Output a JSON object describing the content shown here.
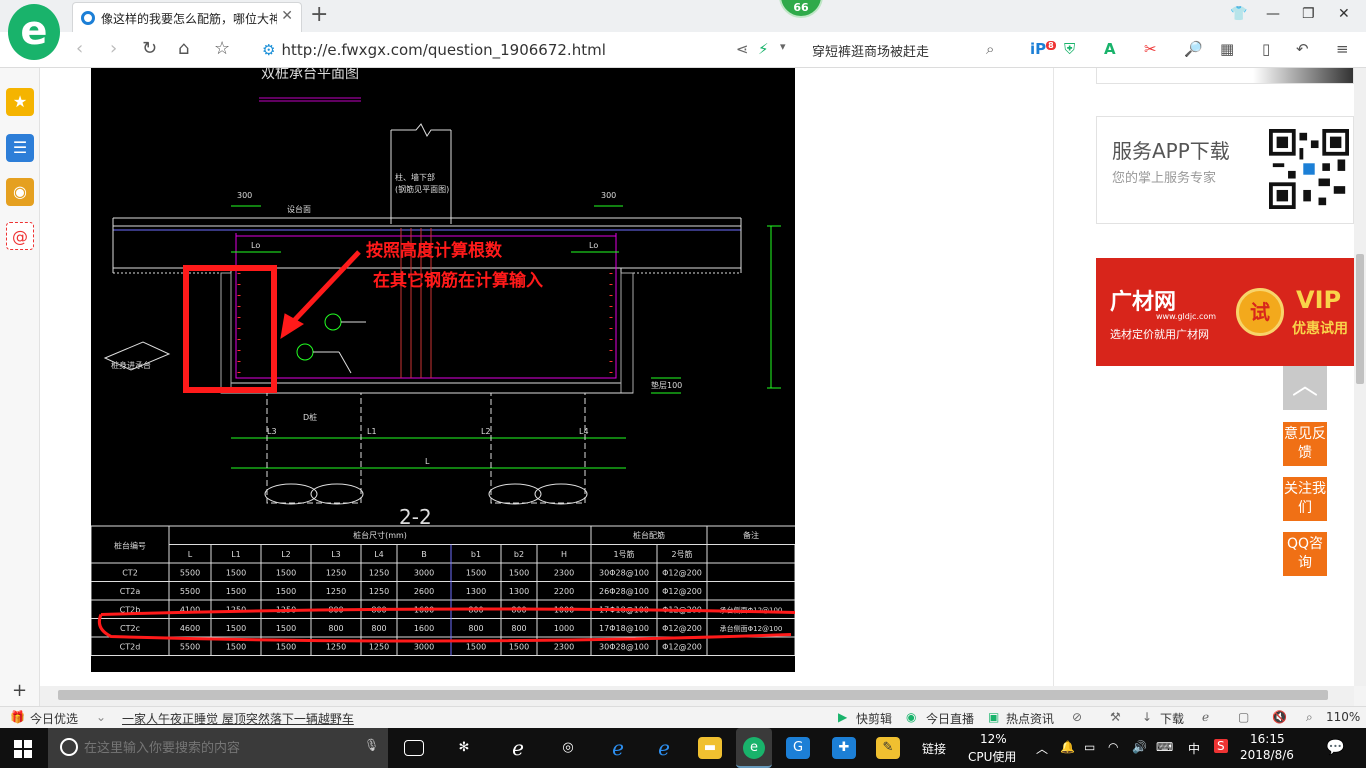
{
  "browser": {
    "tab_title": "像这样的我要怎么配筋，哪位大神",
    "badge": "66",
    "url_text": "http://e.fwxgx.com/question_1906672.html",
    "search_value": "穿短裤逛商场被赶走",
    "plugin_badge": "8"
  },
  "cad": {
    "title_top": "双桩承台平面图",
    "section_label": "2-2",
    "annotation_line1": "按照高度计算根数",
    "annotation_line2": "在其它钢筋在计算输入",
    "dims": {
      "d300a": "300",
      "d300b": "300",
      "lo_left": "Lo",
      "lo_right": "Lo",
      "l3": "L3",
      "l1": "L1",
      "l2": "L2",
      "l4": "L4",
      "l": "L",
      "dia": "D桩"
    },
    "labels": {
      "slab": "设台面",
      "column": "柱、墙下部",
      "column2": "(钢筋见平面图)",
      "bottom_label": "垫层100",
      "pile_note": "桩身进承台"
    },
    "table": {
      "header_group": "桩台尺寸(mm)",
      "header_rebar": "桩台配筋",
      "header_note": "备注",
      "header_id": "桩台编号",
      "columns": [
        "L",
        "L1",
        "L2",
        "L3",
        "L4",
        "B",
        "b1",
        "b2",
        "H",
        "1号筋",
        "2号筋"
      ],
      "rows": [
        {
          "id": "CT2",
          "cells": [
            "5500",
            "1500",
            "1500",
            "1250",
            "1250",
            "3000",
            "1500",
            "1500",
            "2300",
            "30Φ28@100",
            "Φ12@200"
          ],
          "note": ""
        },
        {
          "id": "CT2a",
          "cells": [
            "5500",
            "1500",
            "1500",
            "1250",
            "1250",
            "2600",
            "1300",
            "1300",
            "2200",
            "26Φ28@100",
            "Φ12@200"
          ],
          "note": ""
        },
        {
          "id": "CT2b",
          "cells": [
            "4100",
            "1250",
            "1250",
            "800",
            "800",
            "1600",
            "800",
            "800",
            "1000",
            "17Φ18@100",
            "Φ12@200"
          ],
          "note": "承台侧面Φ12@100"
        },
        {
          "id": "CT2c",
          "cells": [
            "4600",
            "1500",
            "1500",
            "800",
            "800",
            "1600",
            "800",
            "800",
            "1000",
            "17Φ18@100",
            "Φ12@200"
          ],
          "note": "承台侧面Φ12@100"
        },
        {
          "id": "CT2d",
          "cells": [
            "5500",
            "1500",
            "1500",
            "1250",
            "1250",
            "3000",
            "1500",
            "1500",
            "2300",
            "30Φ28@100",
            "Φ12@200"
          ],
          "note": ""
        }
      ]
    }
  },
  "sidebar_right": {
    "app_title": "服务APP下载",
    "app_subtitle": "您的掌上服务专家",
    "ad": {
      "logo": "广材网",
      "url": "www.gldjc.com",
      "slogan": "选材定价就用广材网",
      "try": "试",
      "vip": "VIP",
      "vip_sub": "优惠试用"
    },
    "buttons": {
      "feedback": "意见反馈",
      "follow": "关注我们",
      "qq": "QQ咨询"
    }
  },
  "statusbar": {
    "today": "今日优选",
    "news": "一家人午夜正睡觉 屋顶突然落下一辆越野车",
    "clip": "快剪辑",
    "live": "今日直播",
    "hot": "热点资讯",
    "download": "下载",
    "zoom": "110%"
  },
  "taskbar": {
    "search_placeholder": "在这里输入你要搜索的内容",
    "link": "链接",
    "cpu_pct": "12%",
    "cpu_label": "CPU使用",
    "ime": "中",
    "time": "16:15",
    "date": "2018/8/6"
  },
  "colors": {
    "accent_green": "#19b36b",
    "annotation_red": "#ff1a1a",
    "float_orange": "#f07015",
    "ad_red": "#d8251b"
  }
}
